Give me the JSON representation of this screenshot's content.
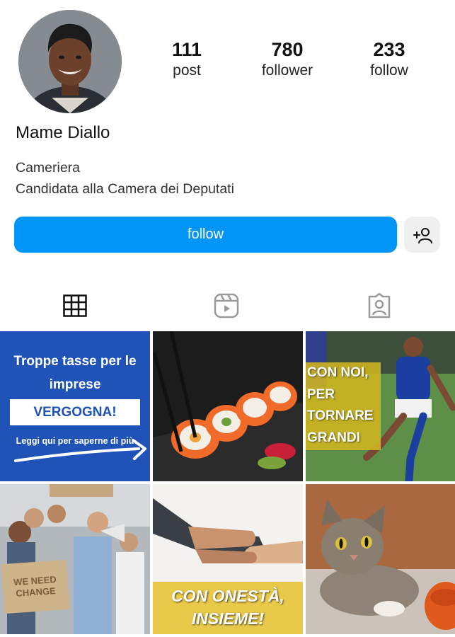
{
  "profile": {
    "name": "Mame Diallo",
    "bio_lines": [
      "Cameriera",
      "Candidata alla Camera dei Deputati"
    ]
  },
  "stats": [
    {
      "value": "111",
      "label": "post"
    },
    {
      "value": "780",
      "label": "follower"
    },
    {
      "value": "233",
      "label": "follow"
    }
  ],
  "actions": {
    "follow_label": "follow",
    "add_person_icon": "add-person-icon"
  },
  "tabs": [
    {
      "icon": "grid-icon"
    },
    {
      "icon": "reels-icon"
    },
    {
      "icon": "tagged-icon"
    }
  ],
  "posts": {
    "p1": {
      "headline": "Troppe tasse per le imprese",
      "box_text": "VERGOGNA!",
      "subtext": "Leggi qui per saperne di più"
    },
    "p3": {
      "lines": [
        "CON NOI,",
        "PER",
        "TORNARE",
        "GRANDI"
      ]
    },
    "p4": {
      "sign": "WE NEED CHANGE"
    },
    "p5": {
      "lines": [
        "CON ONESTÀ,",
        "INSIEME!"
      ]
    }
  },
  "colors": {
    "accent": "#0095f6",
    "post1_bg": "#1f53b8",
    "post3_overlay": "#d2b620",
    "post5_band": "#e9c94a"
  }
}
